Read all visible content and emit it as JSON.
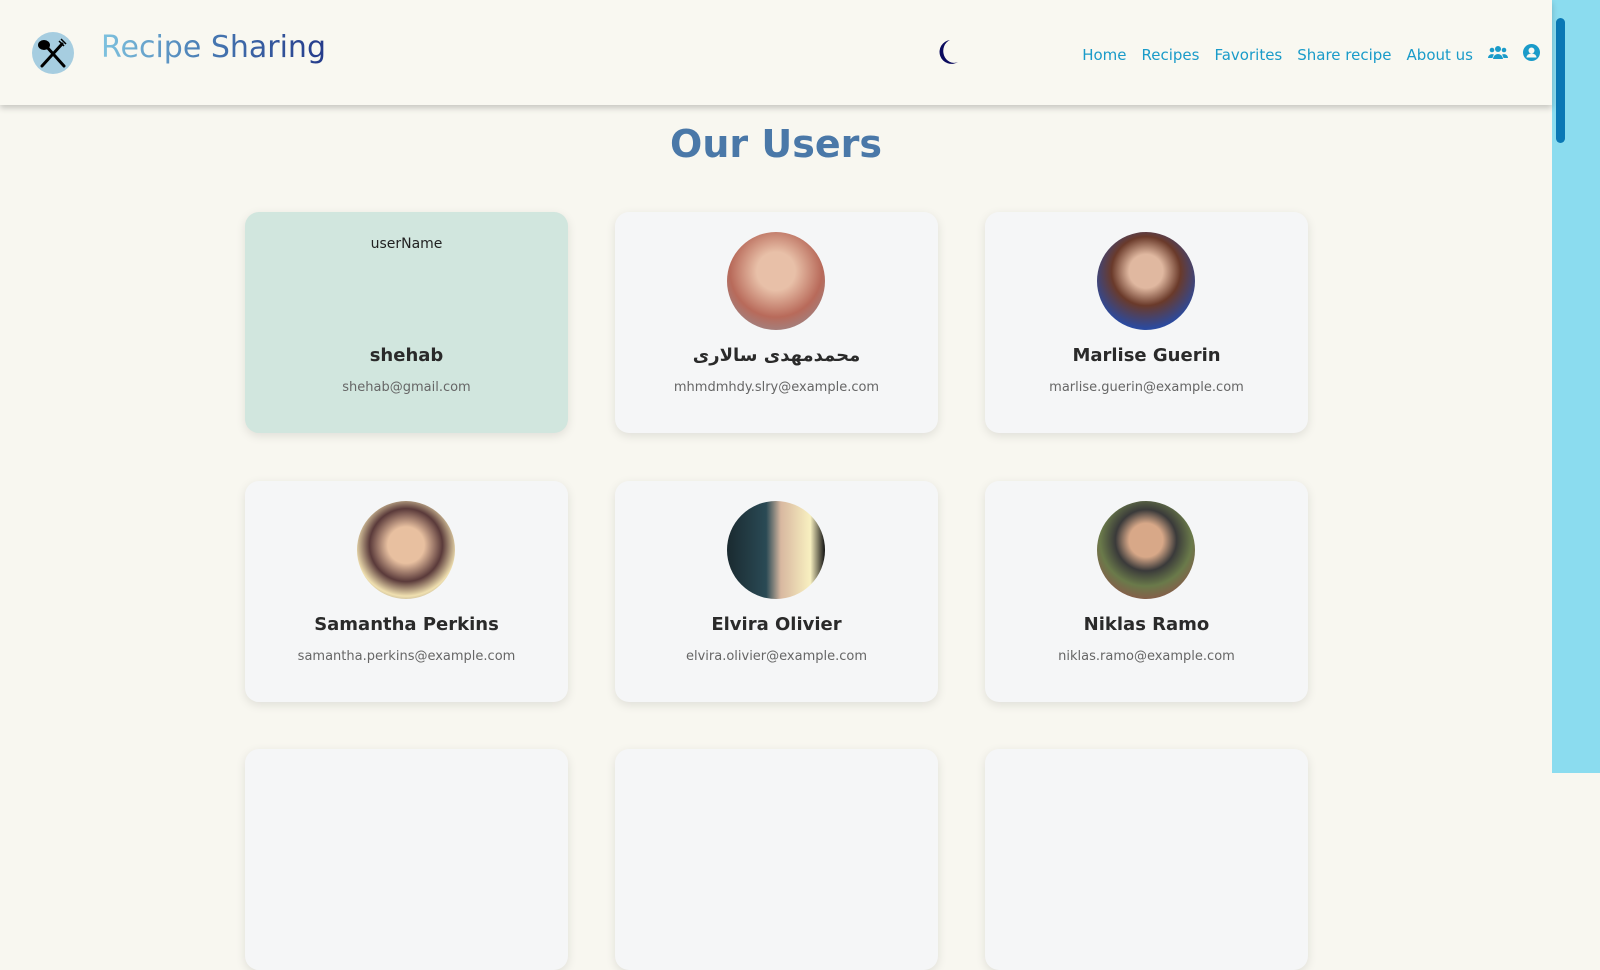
{
  "header": {
    "brand": "Recipe Sharing",
    "nav": [
      "Home",
      "Recipes",
      "Favorites",
      "Share recipe",
      "About us"
    ]
  },
  "page": {
    "title": "Our Users"
  },
  "users": [
    {
      "name": "shehab",
      "email": "shehab@gmail.com",
      "alt": "userName",
      "color": "#d1e6de"
    },
    {
      "name": "محمدمهدی سالاری",
      "email": "mhmdmhdy.slry@example.com",
      "color": "#b86a5a"
    },
    {
      "name": "Marlise Guerin",
      "email": "marlise.guerin@example.com",
      "color": "#7a4a3a"
    },
    {
      "name": "Samantha Perkins",
      "email": "samantha.perkins@example.com",
      "color": "#c9a56a"
    },
    {
      "name": "Elvira Olivier",
      "email": "elvira.olivier@example.com",
      "color": "#2a4a55"
    },
    {
      "name": "Niklas Ramo",
      "email": "niklas.ramo@example.com",
      "color": "#6a5a4a"
    }
  ],
  "colors": {
    "accent": "#1a9bc9",
    "title": "#4a78a8"
  }
}
